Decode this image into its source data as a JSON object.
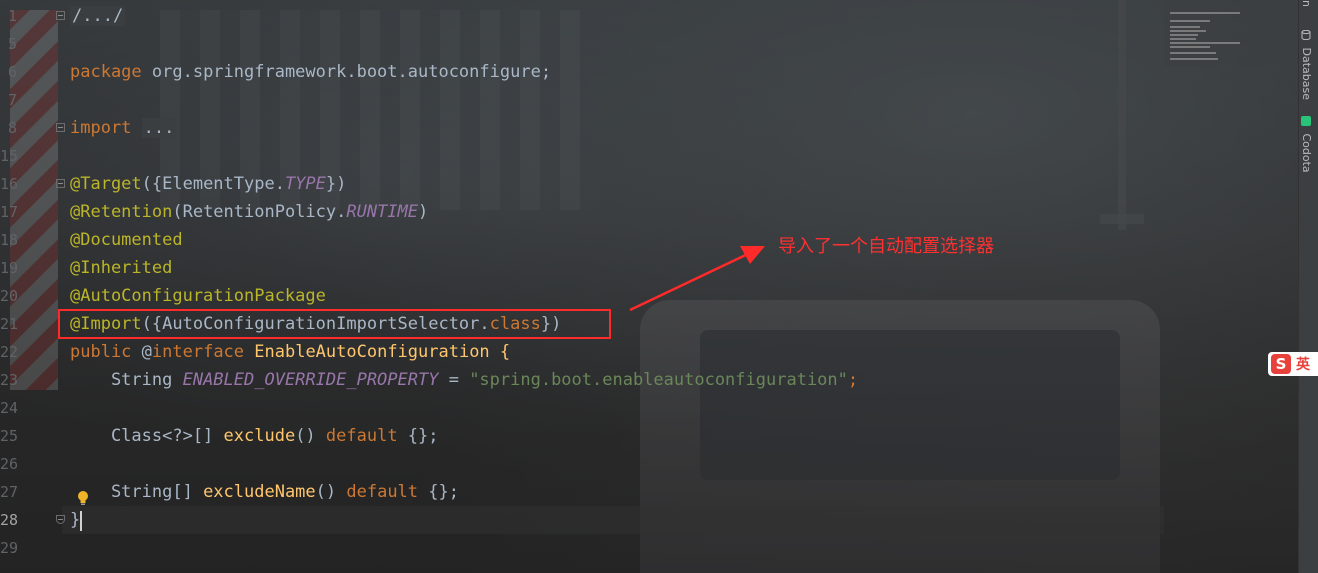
{
  "editor": {
    "line_numbers": [
      "1",
      "5",
      "6",
      "7",
      "8",
      "15",
      "16",
      "17",
      "18",
      "19",
      "20",
      "21",
      "22",
      "23",
      "24",
      "25",
      "26",
      "27",
      "28",
      "29"
    ],
    "current_line": "28",
    "lines": {
      "l1": "/.../",
      "l6_kw": "package",
      "l6_rest": " org.springframework.boot.autoconfigure;",
      "l8_kw": "import",
      "l8_fold": "...",
      "l16_ann": "@Target",
      "l16_a": "({ElementType.",
      "l16_b": "TYPE",
      "l16_c": "})",
      "l17_ann": "@Retention",
      "l17_a": "(RetentionPolicy.",
      "l17_b": "RUNTIME",
      "l17_c": ")",
      "l18_ann": "@Documented",
      "l19_ann": "@Inherited",
      "l20_ann": "@AutoConfigurationPackage",
      "l21_ann": "@Import",
      "l21_a": "({AutoConfigurationImportSelector.",
      "l21_b": "class",
      "l21_c": "})",
      "l22_kw1": "public",
      "l22_a": " @",
      "l22_kw2": "interface",
      "l22_b": " EnableAutoConfiguration {",
      "l23_a": "    String ",
      "l23_b": "ENABLED_OVERRIDE_PROPERTY",
      "l23_c": " = ",
      "l23_str": "\"spring.boot.enableautoconfiguration\"",
      "l23_d": ";",
      "l25_a": "    Class<?>[] ",
      "l25_m": "exclude",
      "l25_b": "() ",
      "l25_kw": "default",
      "l25_c": " {};",
      "l27_a": "    String[] ",
      "l27_m": "excludeName",
      "l27_b": "() ",
      "l27_kw": "default",
      "l27_c": " {};",
      "l28": "}"
    }
  },
  "annotation": {
    "callout_text": "导入了一个自动配置选择器",
    "color": "#ff2a2a"
  },
  "right_toolbar": {
    "tab_top": "n",
    "tab_database": "Database",
    "tab_codota": "Codota"
  },
  "ime_indicator": {
    "logo": "S",
    "label": "英"
  },
  "colors": {
    "keyword": "#cc7832",
    "annotation": "#bbb529",
    "constant": "#9876aa",
    "string": "#6a8759",
    "method": "#ffc66d",
    "text": "#a9b7c6"
  }
}
